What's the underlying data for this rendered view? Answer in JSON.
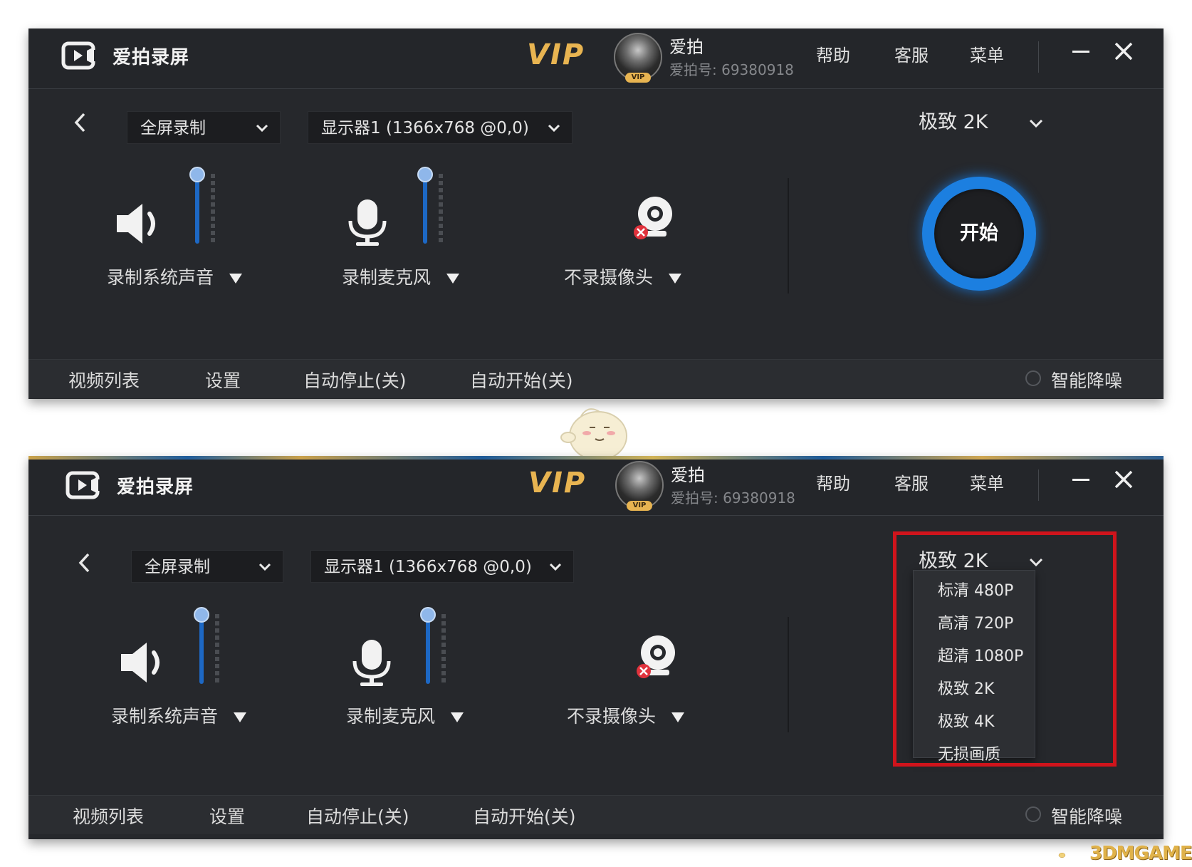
{
  "app": {
    "title": "爱拍录屏",
    "vip_label": "VIP",
    "avatar_badge": "VIP"
  },
  "user": {
    "name": "爱拍",
    "id_text": "爱拍号: 69380918"
  },
  "menu": {
    "help": "帮助",
    "service": "客服",
    "menu": "菜单"
  },
  "controls": {
    "mode_select": "全屏录制",
    "display_select": "显示器1 (1366x768 @0,0)",
    "quality_select": "极致 2K"
  },
  "devices": {
    "system_audio": {
      "label": "录制系统声音",
      "level": 1.0
    },
    "microphone": {
      "label": "录制麦克风",
      "level": 1.0
    },
    "camera": {
      "label": "不录摄像头"
    }
  },
  "start_button": "开始",
  "bottom": {
    "video_list": "视频列表",
    "settings": "设置",
    "auto_stop": "自动停止(关)",
    "auto_start": "自动开始(关)",
    "noise_reduction": "智能降噪"
  },
  "quality_options": [
    "标清 480P",
    "高清 720P",
    "超清 1080P",
    "极致 2K",
    "极致 4K",
    "无损画质"
  ],
  "watermark": "3DMGAME",
  "colors": {
    "panel_bg": "#26282c",
    "accent_blue": "#1c7fe0",
    "vip_gold": "#e8b451",
    "highlight_red": "#d0141c"
  }
}
